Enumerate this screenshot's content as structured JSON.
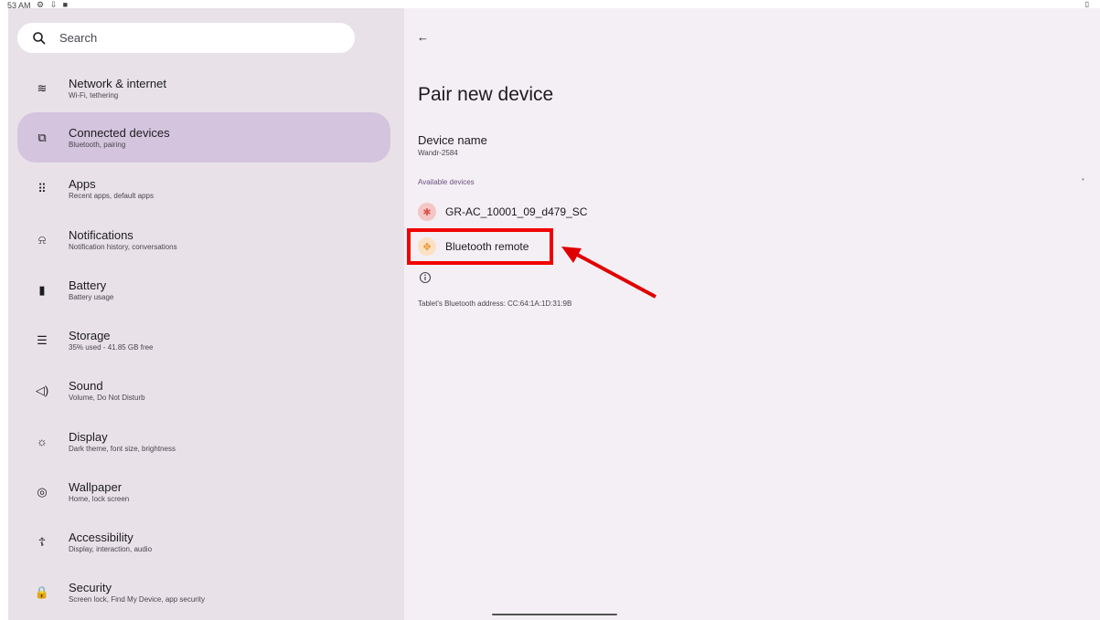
{
  "status_bar": {
    "time": "53 AM",
    "icons": "⚙ ⇩ ■",
    "battery": "▯"
  },
  "search": {
    "placeholder": "Search"
  },
  "sidebar": {
    "items": [
      {
        "title": "Network & internet",
        "subtitle": "Wi-Fi, tethering",
        "icon": "wifi-icon",
        "glyph": "≋"
      },
      {
        "title": "Connected devices",
        "subtitle": "Bluetooth, pairing",
        "icon": "connected-devices-icon",
        "glyph": "⧉",
        "selected": true
      },
      {
        "title": "Apps",
        "subtitle": "Recent apps, default apps",
        "icon": "apps-icon",
        "glyph": "⠿"
      },
      {
        "title": "Notifications",
        "subtitle": "Notification history, conversations",
        "icon": "bell-icon",
        "glyph": "⍾"
      },
      {
        "title": "Battery",
        "subtitle": "Battery usage",
        "icon": "battery-icon",
        "glyph": "▮"
      },
      {
        "title": "Storage",
        "subtitle": "35% used - 41.85 GB free",
        "icon": "storage-icon",
        "glyph": "☰"
      },
      {
        "title": "Sound",
        "subtitle": "Volume, Do Not Disturb",
        "icon": "speaker-icon",
        "glyph": "◁)"
      },
      {
        "title": "Display",
        "subtitle": "Dark theme, font size, brightness",
        "icon": "brightness-icon",
        "glyph": "☼"
      },
      {
        "title": "Wallpaper",
        "subtitle": "Home, lock screen",
        "icon": "palette-icon",
        "glyph": "◎"
      },
      {
        "title": "Accessibility",
        "subtitle": "Display, interaction, audio",
        "icon": "accessibility-icon",
        "glyph": "☦"
      },
      {
        "title": "Security",
        "subtitle": "Screen lock, Find My Device, app security",
        "icon": "lock-icon",
        "glyph": "🔒"
      }
    ]
  },
  "main": {
    "back_icon": "←",
    "title": "Pair new device",
    "device_name_label": "Device name",
    "device_name_value": "Wandr-2584",
    "available_header": "Available devices",
    "devices": [
      {
        "name": "GR-AC_10001_09_d479_SC",
        "icon": "bluetooth-icon",
        "glyph": "✱",
        "bg": "#f4c6c6",
        "fg": "#d9534f"
      },
      {
        "name": "Bluetooth remote",
        "icon": "gamepad-icon",
        "glyph": "✥",
        "bg": "#fbe0c2",
        "fg": "#e8952e"
      }
    ],
    "bt_address": "Tablet's Bluetooth address: CC:64:1A:1D:31:9B"
  },
  "annotation": {
    "box_color": "#f00000",
    "arrow_color": "#e00000"
  }
}
